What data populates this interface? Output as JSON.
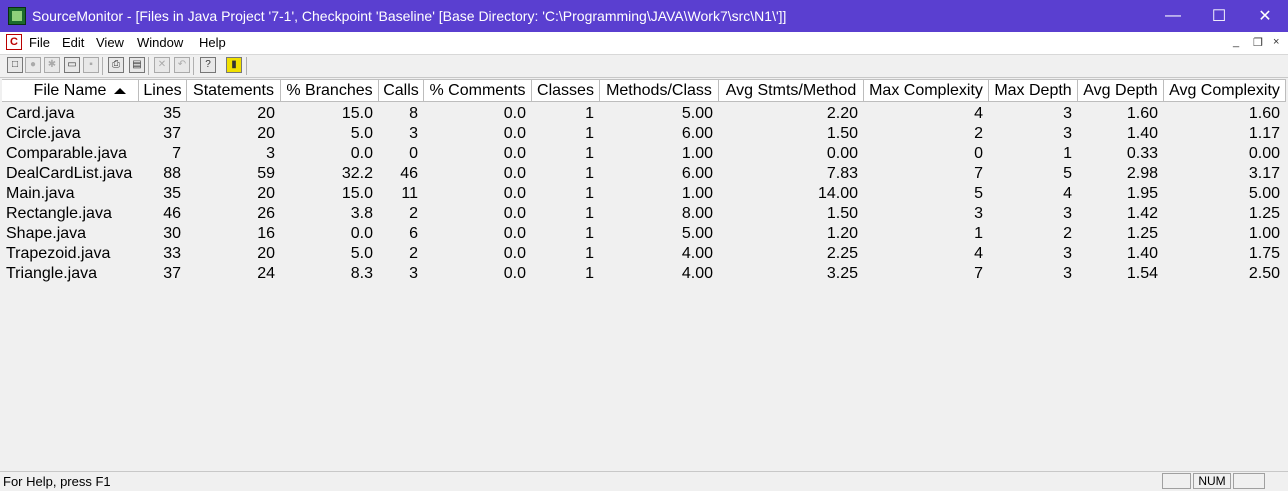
{
  "window": {
    "title": "SourceMonitor - [Files in Java Project '7-1', Checkpoint 'Baseline'  [Base Directory: 'C:\\Programming\\JAVA\\Work7\\src\\N1\\']]",
    "minimize_glyph": "—",
    "maximize_glyph": "☐",
    "close_glyph": "✕"
  },
  "menu": {
    "doc_icon_glyph": "C",
    "items": [
      "File",
      "Edit",
      "View",
      "Window",
      "Help"
    ],
    "mdi_minimize": "_",
    "mdi_restore": "❐",
    "mdi_close": "×"
  },
  "toolbar": {
    "buttons": [
      {
        "icon": "new-file-icon",
        "glyph": "□"
      },
      {
        "icon": "circle-icon",
        "glyph": "●"
      },
      {
        "icon": "gear-icon",
        "glyph": "✱"
      },
      {
        "icon": "open-folder-icon",
        "glyph": "▭"
      },
      {
        "icon": "save-icon",
        "glyph": "▪"
      },
      {
        "icon": "print-icon",
        "glyph": "⎙"
      },
      {
        "icon": "print-preview-icon",
        "glyph": "▤"
      },
      {
        "icon": "delete-icon",
        "glyph": "✕"
      },
      {
        "icon": "undo-icon",
        "glyph": "↶"
      },
      {
        "icon": "context-help-icon",
        "glyph": "?"
      },
      {
        "icon": "exit-icon",
        "glyph": "▮"
      }
    ]
  },
  "table": {
    "columns": [
      "File Name",
      "Lines",
      "Statements",
      "% Branches",
      "Calls",
      "% Comments",
      "Classes",
      "Methods/Class",
      "Avg Stmts/Method",
      "Max Complexity",
      "Max Depth",
      "Avg Depth",
      "Avg Complexity"
    ],
    "sorted_column": "File Name",
    "rows": [
      [
        "Card.java",
        "35",
        "20",
        "15.0",
        "8",
        "0.0",
        "1",
        "5.00",
        "2.20",
        "4",
        "3",
        "1.60",
        "1.60"
      ],
      [
        "Circle.java",
        "37",
        "20",
        "5.0",
        "3",
        "0.0",
        "1",
        "6.00",
        "1.50",
        "2",
        "3",
        "1.40",
        "1.17"
      ],
      [
        "Comparable.java",
        "7",
        "3",
        "0.0",
        "0",
        "0.0",
        "1",
        "1.00",
        "0.00",
        "0",
        "1",
        "0.33",
        "0.00"
      ],
      [
        "DealCardList.java",
        "88",
        "59",
        "32.2",
        "46",
        "0.0",
        "1",
        "6.00",
        "7.83",
        "7",
        "5",
        "2.98",
        "3.17"
      ],
      [
        "Main.java",
        "35",
        "20",
        "15.0",
        "11",
        "0.0",
        "1",
        "1.00",
        "14.00",
        "5",
        "4",
        "1.95",
        "5.00"
      ],
      [
        "Rectangle.java",
        "46",
        "26",
        "3.8",
        "2",
        "0.0",
        "1",
        "8.00",
        "1.50",
        "3",
        "3",
        "1.42",
        "1.25"
      ],
      [
        "Shape.java",
        "30",
        "16",
        "0.0",
        "6",
        "0.0",
        "1",
        "5.00",
        "1.20",
        "1",
        "2",
        "1.25",
        "1.00"
      ],
      [
        "Trapezoid.java",
        "33",
        "20",
        "5.0",
        "2",
        "0.0",
        "1",
        "4.00",
        "2.25",
        "4",
        "3",
        "1.40",
        "1.75"
      ],
      [
        "Triangle.java",
        "37",
        "24",
        "8.3",
        "3",
        "0.0",
        "1",
        "4.00",
        "3.25",
        "7",
        "3",
        "1.54",
        "2.50"
      ]
    ]
  },
  "status": {
    "help_text": "For Help, press F1",
    "num_indicator": "NUM"
  },
  "colors": {
    "title_bar": "#5a3fd0",
    "window_bg": "#f0f0f0"
  }
}
